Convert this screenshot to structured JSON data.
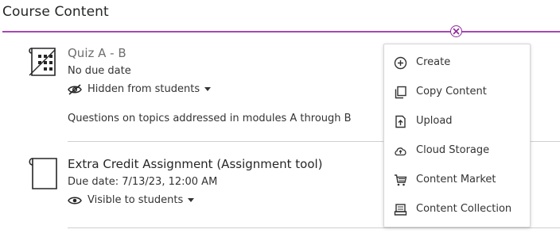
{
  "header": {
    "title": "Course Content"
  },
  "items": [
    {
      "title": "Quiz A - B",
      "subtitle": "No due date",
      "visibility": "Hidden from students",
      "description": "Questions on topics addressed in modules A through B",
      "icon": "test-icon",
      "title_color": "#6e6e6e"
    },
    {
      "title": "Extra Credit Assignment (Assignment tool)",
      "subtitle": "Due date: 7/13/23, 12:00 AM",
      "visibility": "Visible to students",
      "icon": "assignment-icon",
      "title_color": "#262626"
    }
  ],
  "menu": {
    "items": [
      {
        "label": "Create",
        "icon": "plus-circle-icon"
      },
      {
        "label": "Copy Content",
        "icon": "copy-icon"
      },
      {
        "label": "Upload",
        "icon": "upload-icon"
      },
      {
        "label": "Cloud Storage",
        "icon": "cloud-upload-icon"
      },
      {
        "label": "Content Market",
        "icon": "cart-icon"
      },
      {
        "label": "Content Collection",
        "icon": "collection-icon"
      }
    ]
  },
  "colors": {
    "accent": "#a845b8",
    "close": "#8c2a9c"
  }
}
